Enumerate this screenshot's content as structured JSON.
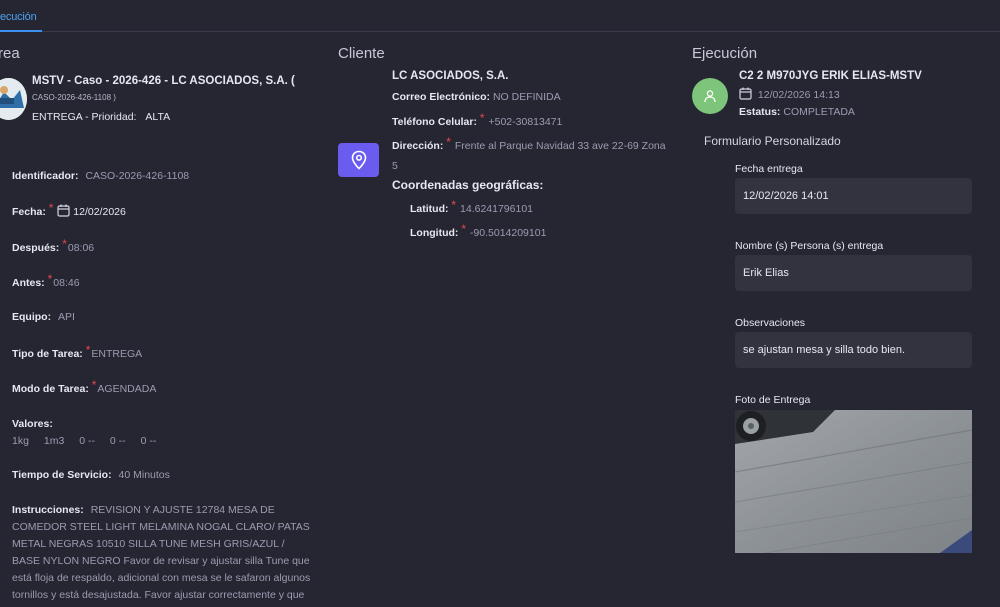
{
  "tabs": {
    "active_label": "ecución"
  },
  "task": {
    "section_title": "rea",
    "name": "MSTV - Caso - 2026-426 - LC ASOCIADOS, S.A. (",
    "code": "CASO-2026-426-1108 )",
    "type_priority_label": "ENTREGA - Prioridad:",
    "priority": "ALTA",
    "fields": {
      "identifier": {
        "label": "Identificador:",
        "value": "CASO-2026-426-1108"
      },
      "date": {
        "label": "Fecha:",
        "value": "12/02/2026"
      },
      "after": {
        "label": "Después:",
        "value": "08:06"
      },
      "before": {
        "label": "Antes:",
        "value": "08:46"
      },
      "team": {
        "label": "Equipo:",
        "value": "API"
      },
      "task_type": {
        "label": "Tipo de Tarea:",
        "value": "ENTREGA"
      },
      "task_mode": {
        "label": "Modo de Tarea:",
        "value": "AGENDADA"
      },
      "values": {
        "label": "Valores:",
        "items": [
          "1kg",
          "1m3",
          "0 --",
          "0 --",
          "0 --"
        ]
      },
      "service_time": {
        "label": "Tiempo de Servicio:",
        "value": "40 Minutos"
      }
    },
    "instructions_label": "Instrucciones:",
    "instructions_text": "REVISION Y AJUSTE 12784 MESA DE COMEDOR STEEL LIGHT MELAMINA NOGAL CLARO/ PATAS METAL NEGRAS 10510 SILLA TUNE MESH GRIS/AZUL / BASE NYLON NEGRO Favor de revisar y ajustar silla Tune que está floja de respaldo, adicional con mesa se le safaron algunos tornillos y está desajustada. Favor ajustar correctamente y que"
  },
  "client": {
    "section_title": "Cliente",
    "name": "LC ASOCIADOS, S.A.",
    "email_label": "Correo Electrónico:",
    "email_value": "NO DEFINIDA",
    "phone_label": "Teléfono Celular:",
    "phone_value": "+502-30813471",
    "address_label": "Dirección:",
    "address_value_1": "Frente al Parque Navidad 33 ave 22-69 Zona",
    "address_value_2": "5",
    "coords_title": "Coordenadas geográficas:",
    "lat_label": "Latitud:",
    "lat_value": "14.6241796101",
    "lng_label": "Longitud:",
    "lng_value": "-90.5014209101",
    "icon": "map-pin-icon",
    "accent": "#6b5cf0"
  },
  "execution": {
    "section_title": "Ejecución",
    "agent": "C2 2 M970JYG ERIK ELIAS-MSTV",
    "datetime": "12/02/2026 14:13",
    "status_label": "Estatus:",
    "status_value": "COMPLETADA",
    "avatar_color": "#7cc57a",
    "form_title": "Formulario Personalizado",
    "form": [
      {
        "label": "Fecha entrega",
        "value": "12/02/2026 14:01"
      },
      {
        "label": "Nombre (s) Persona (s) entrega",
        "value": "Erik Elias"
      },
      {
        "label": "Observaciones",
        "value": "se ajustan mesa y silla todo bien."
      }
    ],
    "photo_label": "Foto de Entrega"
  }
}
